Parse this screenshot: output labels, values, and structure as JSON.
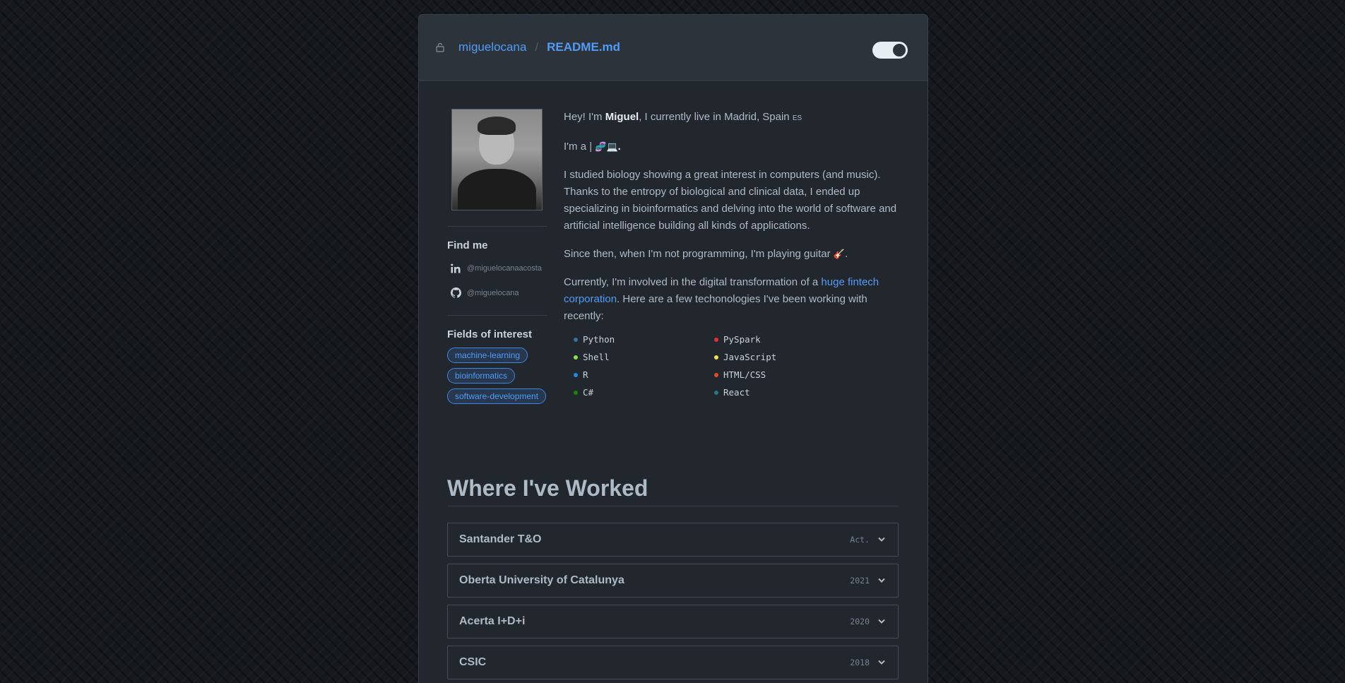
{
  "header": {
    "user": "miguelocana",
    "separator": "/",
    "file": "README.md"
  },
  "sidebar": {
    "find_me_title": "Find me",
    "social": [
      {
        "icon": "linkedin-icon",
        "handle": "@miguelocanaacosta"
      },
      {
        "icon": "github-icon",
        "handle": "@miguelocana"
      }
    ],
    "fields_title": "Fields of interest",
    "tags": [
      "machine-learning",
      "bioinformatics",
      "software-development"
    ]
  },
  "intro": {
    "p1_prefix": "Hey! I'm ",
    "p1_name": "Miguel",
    "p1_suffix": ", I currently live in Madrid, Spain ",
    "p1_flag": "ES",
    "p2_prefix": "I'm a | ",
    "p2_icons": "🧬💻",
    "p2_suffix": ".",
    "p3": "I studied biology showing a great interest in computers (and music). Thanks to the entropy of biological and clinical data, I ended up specializing in bioinformatics and delving into the world of software and artificial intelligence building all kinds of applications.",
    "p4_prefix": "Since then, when I'm not programming, I'm playing guitar ",
    "p4_icon": "🎸",
    "p4_suffix": ".",
    "p5_prefix": "Currently, I'm involved in the digital transformation of a ",
    "p5_link": "huge fintech corporation",
    "p5_suffix": ". Here are a few techonologies I've been working with recently:"
  },
  "languages": [
    {
      "name": "Python",
      "color": "#3572A5"
    },
    {
      "name": "PySpark",
      "color": "#da3434"
    },
    {
      "name": "Shell",
      "color": "#89e051"
    },
    {
      "name": "JavaScript",
      "color": "#f1e05a"
    },
    {
      "name": "R",
      "color": "#198CE7"
    },
    {
      "name": "HTML/CSS",
      "color": "#e34c26"
    },
    {
      "name": "C#",
      "color": "#178600"
    },
    {
      "name": "React",
      "color": "#2b7489"
    }
  ],
  "worked": {
    "title": "Where I've Worked",
    "jobs": [
      {
        "name": "Santander T&O",
        "year": "Act."
      },
      {
        "name": "Oberta University of Catalunya",
        "year": "2021"
      },
      {
        "name": "Acerta I+D+i",
        "year": "2020"
      },
      {
        "name": "CSIC",
        "year": "2018"
      }
    ]
  }
}
